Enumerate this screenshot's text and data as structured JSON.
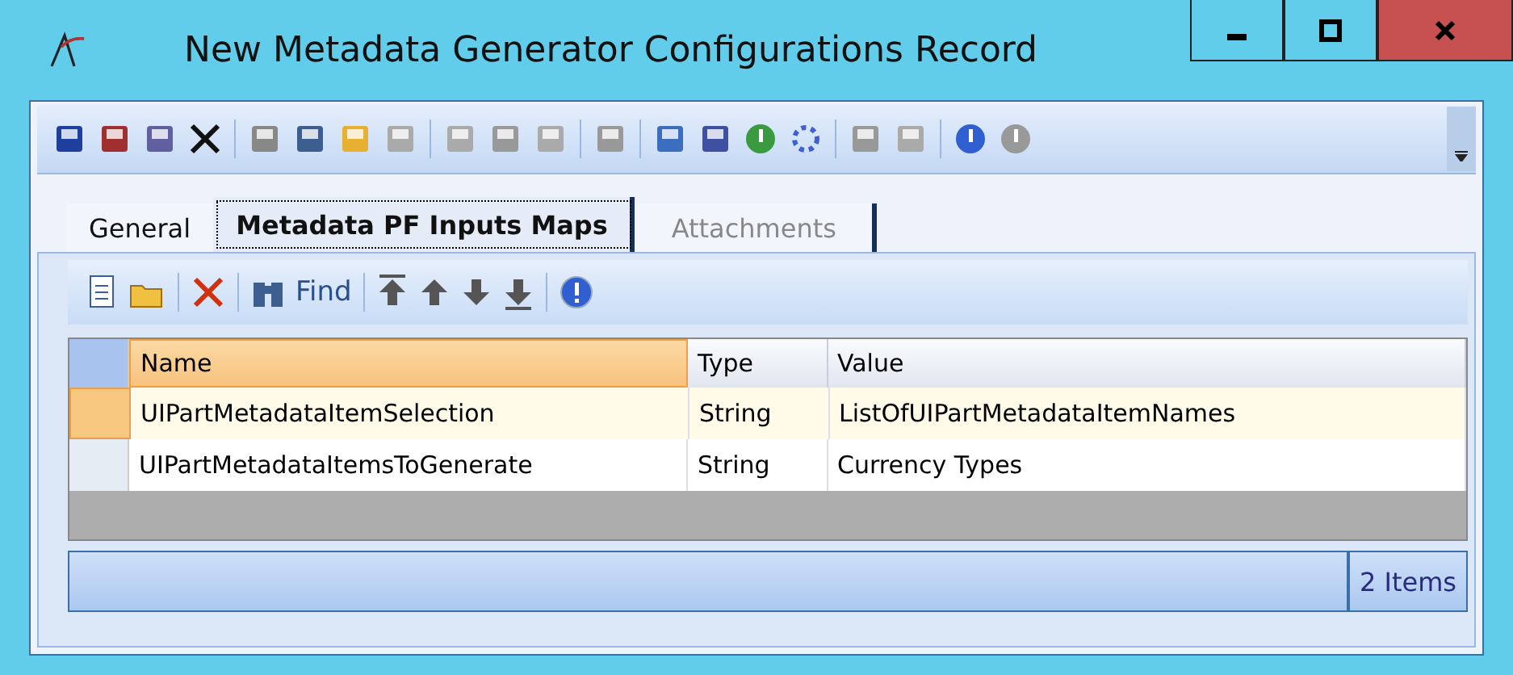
{
  "window": {
    "title": "New Metadata Generator Configurations Record"
  },
  "tabs": [
    {
      "label": "General",
      "selected": false,
      "disabled": false
    },
    {
      "label": "Metadata PF Inputs Maps",
      "selected": true,
      "disabled": false
    },
    {
      "label": "Attachments",
      "selected": false,
      "disabled": true
    }
  ],
  "grid_toolbar": {
    "find_label": "Find"
  },
  "table": {
    "columns": [
      {
        "label": "Name",
        "selected": true
      },
      {
        "label": "Type",
        "selected": false
      },
      {
        "label": "Value",
        "selected": false
      }
    ],
    "rows": [
      {
        "cells": [
          "UIPartMetadataItemSelection",
          "String",
          "ListOfUIPartMetadataItemNames"
        ],
        "selected": true
      },
      {
        "cells": [
          "UIPartMetadataItemsToGenerate",
          "String",
          "Currency Types"
        ],
        "selected": false
      }
    ]
  },
  "status_bar": {
    "count": "2 Items"
  }
}
